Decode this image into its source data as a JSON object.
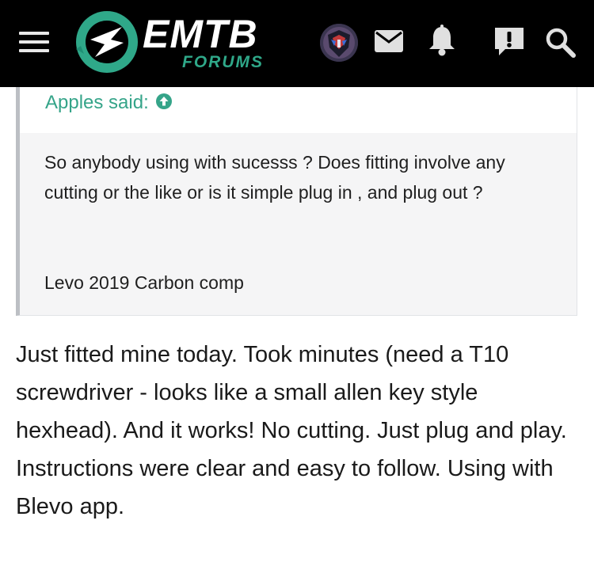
{
  "header": {
    "logo": {
      "main_text": "EMTB",
      "sub_text": "FORUMS",
      "colors": {
        "green": "#2fa889",
        "dark_green": "#1f8f75",
        "white": "#ffffff"
      }
    },
    "icons": [
      "menu-icon",
      "avatar",
      "mail-icon",
      "bell-icon",
      "alert-icon",
      "search-icon"
    ],
    "background": "#000000"
  },
  "quote": {
    "author_said": "Apples said:",
    "body": "So anybody using with sucesss ? Does fitting involve any cutting or the like or is it simple plug in , and plug out ?",
    "signature": "Levo 2019 Carbon comp",
    "accent_color": "#35a489"
  },
  "post": {
    "text": "Just fitted mine today. Took minutes (need a T10 screwdriver - looks like a small allen key style hexhead). And it works! No cutting. Just plug and play. Instructions were clear and easy to follow. Using with Blevo app."
  }
}
